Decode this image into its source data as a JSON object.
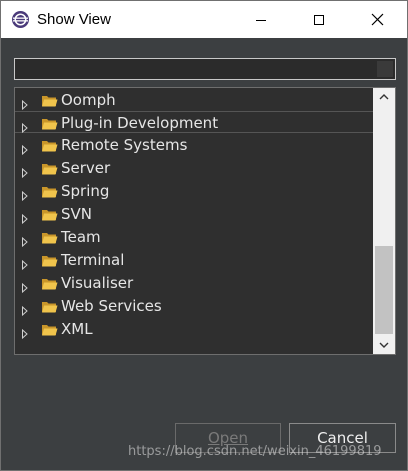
{
  "window": {
    "title": "Show View"
  },
  "filter": {
    "value": "",
    "placeholder": ""
  },
  "tree": {
    "items": [
      {
        "label": "Oomph"
      },
      {
        "label": "Plug-in Development",
        "selected": true
      },
      {
        "label": "Remote Systems"
      },
      {
        "label": "Server"
      },
      {
        "label": "Spring"
      },
      {
        "label": "SVN"
      },
      {
        "label": "Team"
      },
      {
        "label": "Terminal"
      },
      {
        "label": "Visualiser"
      },
      {
        "label": "Web Services"
      },
      {
        "label": "XML"
      }
    ]
  },
  "buttons": {
    "open_label": "Open",
    "cancel_label": "Cancel"
  },
  "watermark": "https://blog.csdn.net/weixin_46199819",
  "colors": {
    "folder": "#e8b840",
    "background": "#3c3f41",
    "tree_bg": "#2f2f2f"
  }
}
